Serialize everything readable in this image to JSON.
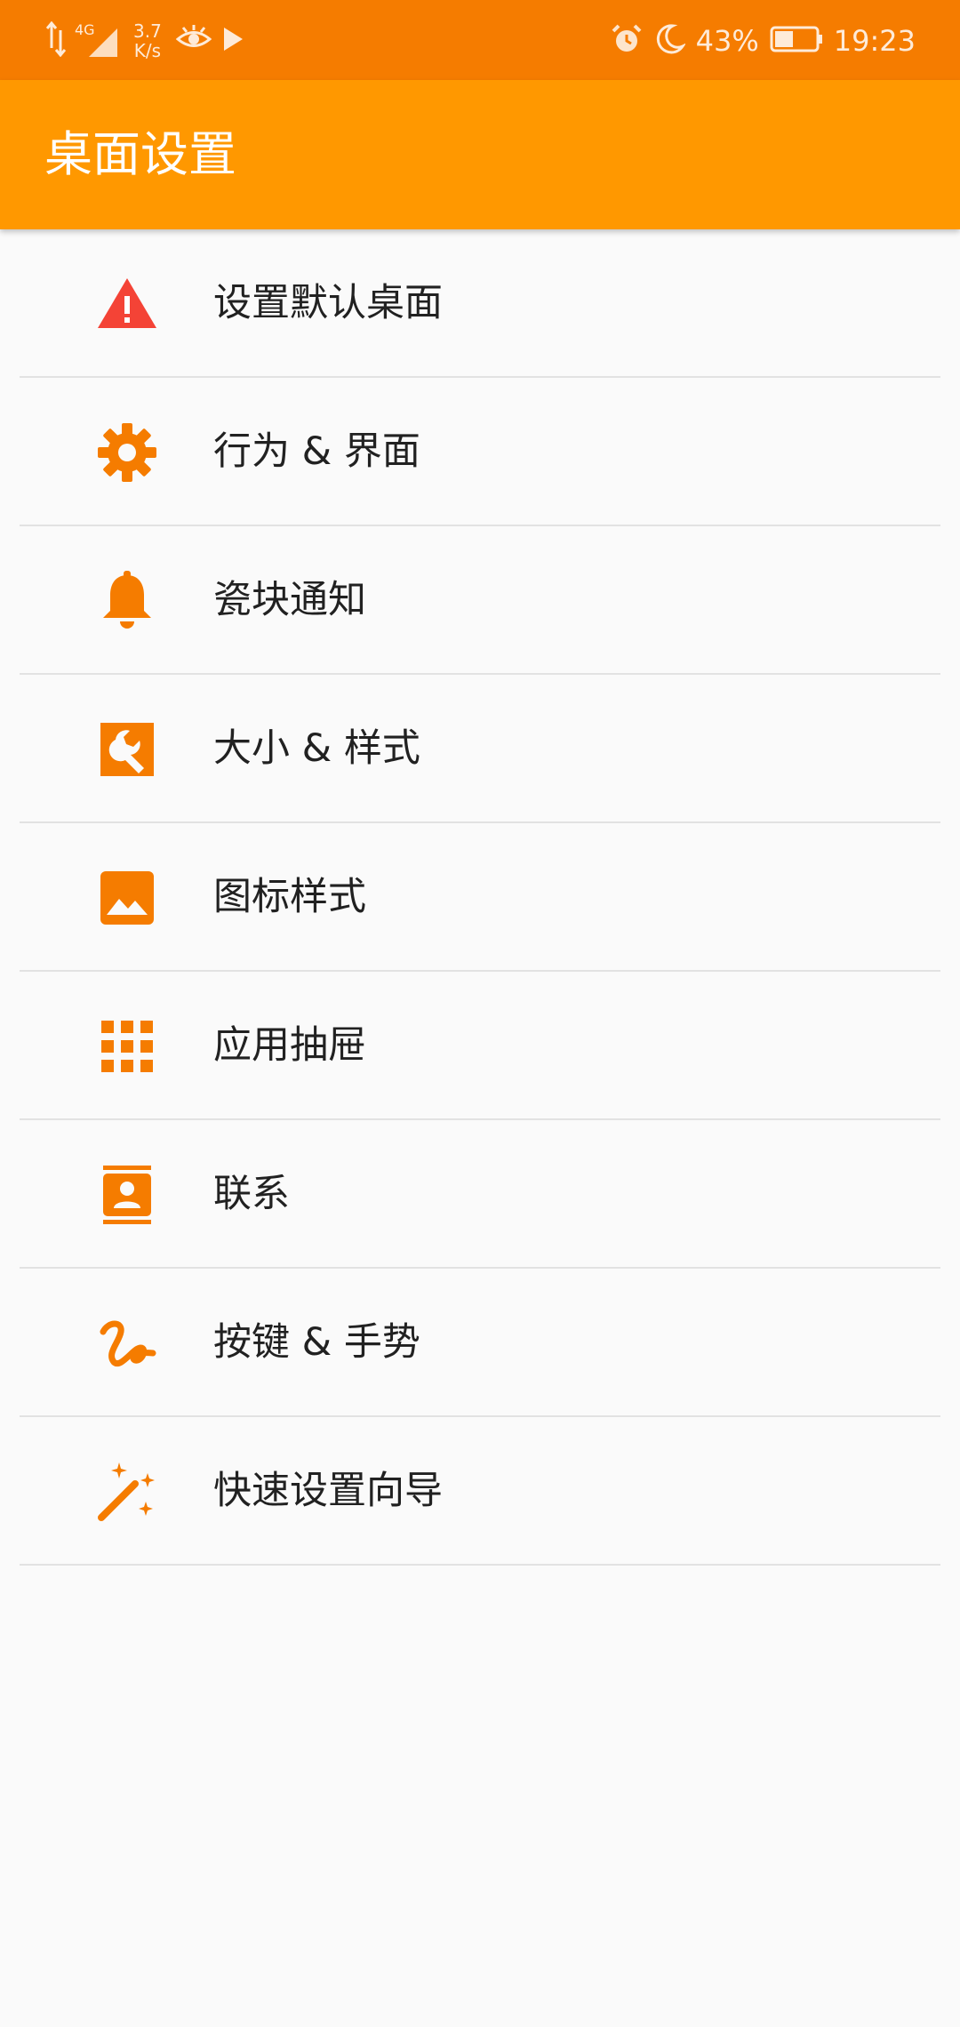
{
  "status_bar": {
    "signal_label": "4G",
    "net_speed_value": "3.7",
    "net_speed_unit": "K/s",
    "battery": "43%",
    "time": "19:23",
    "icons": [
      "data-arrows-icon",
      "signal-icon",
      "eye-icon",
      "play-icon",
      "alarm-icon",
      "moon-icon",
      "battery-icon"
    ]
  },
  "app_bar": {
    "title": "桌面设置"
  },
  "colors": {
    "status_bar": "#f57c00",
    "app_bar": "#ff9800",
    "icon_accent": "#f57c00",
    "warning_icon": "#f44336",
    "background": "#fafafa",
    "text": "#212121",
    "divider": "#e2e2e2"
  },
  "settings": {
    "items": [
      {
        "label": "设置默认桌面",
        "icon": "warning-icon"
      },
      {
        "label": "行为 & 界面",
        "icon": "gear-icon"
      },
      {
        "label": "瓷块通知",
        "icon": "bell-icon"
      },
      {
        "label": "大小 & 样式",
        "icon": "wrench-icon"
      },
      {
        "label": "图标样式",
        "icon": "image-icon"
      },
      {
        "label": "应用抽屉",
        "icon": "grid-icon"
      },
      {
        "label": "联系",
        "icon": "contact-icon"
      },
      {
        "label": "按键 & 手势",
        "icon": "gesture-icon"
      },
      {
        "label": "快速设置向导",
        "icon": "magic-wand-icon"
      }
    ]
  }
}
